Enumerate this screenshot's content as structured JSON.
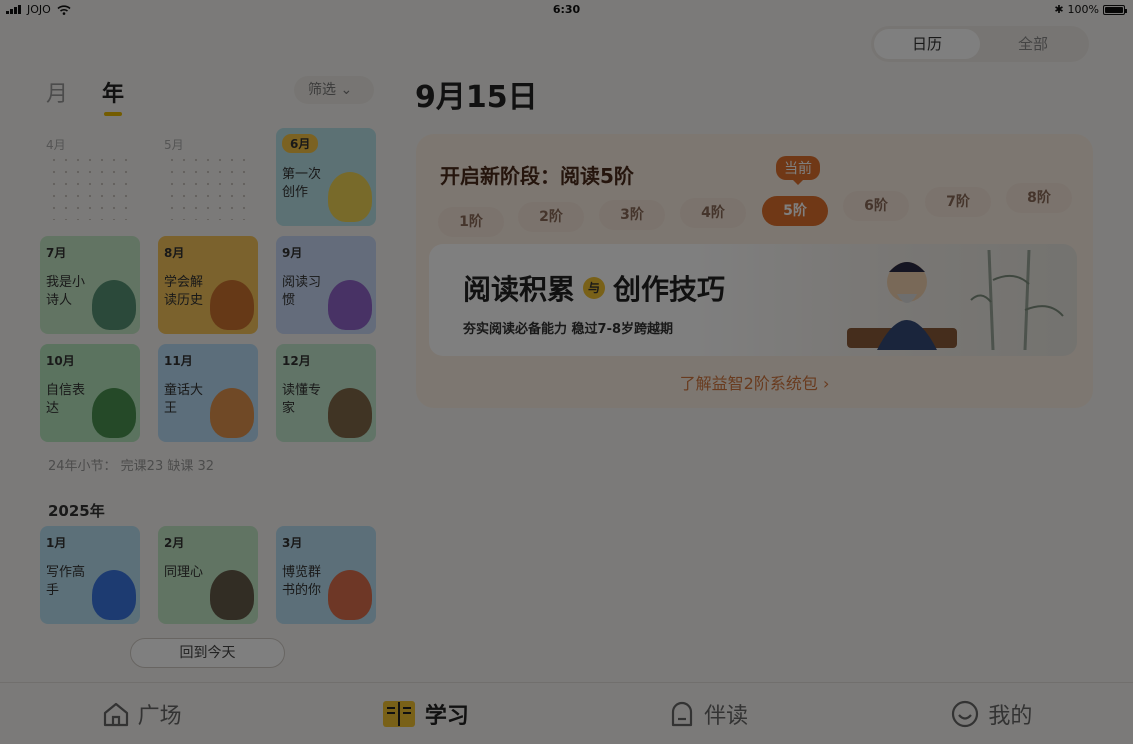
{
  "status": {
    "carrier": "JOJO",
    "time": "6:30",
    "battery": "100%",
    "battery_level": 1.0
  },
  "view_toggle": {
    "options": [
      "日历",
      "全部"
    ],
    "active": "日历"
  },
  "left": {
    "tabs": [
      "月",
      "年"
    ],
    "active_tab": "年",
    "filter_label": "筛选",
    "rows": [
      [
        {
          "month": "4月",
          "label": "",
          "empty": true
        },
        {
          "month": "5月",
          "label": "",
          "empty": true
        },
        {
          "month": "6月",
          "label": "第一次创作",
          "color": "#b8e2e8",
          "mascot": "#f6d445",
          "highlight": true
        }
      ],
      [
        {
          "month": "7月",
          "label": "我是小诗人",
          "color": "#c5e8c6",
          "mascot": "#4a8a6a"
        },
        {
          "month": "8月",
          "label": "学会解读历史",
          "color": "#f6c45a",
          "mascot": "#c86a2a"
        },
        {
          "month": "9月",
          "label": "阅读习惯",
          "color": "#c8d8f6",
          "mascot": "#8a58c6"
        }
      ],
      [
        {
          "month": "10月",
          "label": "自信表达",
          "color": "#b6e6bf",
          "mascot": "#3e8a44"
        },
        {
          "month": "11月",
          "label": "童话大王",
          "color": "#b9dcf6",
          "mascot": "#e48a3a"
        },
        {
          "month": "12月",
          "label": "读懂专家",
          "color": "#c3e8cf",
          "mascot": "#7a5a3a"
        }
      ]
    ],
    "summary": "24年小节：  完课23  缺课 32",
    "year_label": "2025年",
    "rows_2025": [
      {
        "month": "1月",
        "label": "写作高手",
        "color": "#b8e0f2",
        "mascot": "#2e6ae0"
      },
      {
        "month": "2月",
        "label": "同理心",
        "color": "#c3e8c7",
        "mascot": "#5a4a3a"
      },
      {
        "month": "3月",
        "label": "博览群书的你",
        "color": "#b8dff2",
        "mascot": "#e0623a"
      }
    ],
    "today_button": "回到今天"
  },
  "right": {
    "date": "9月15日",
    "stage_title": "开启新阶段：阅读5阶",
    "current_badge": "当前",
    "stages": [
      "1阶",
      "2阶",
      "3阶",
      "4阶",
      "5阶",
      "6阶",
      "7阶",
      "8阶"
    ],
    "active_stage": "5阶",
    "banner_left": "阅读积累",
    "banner_mid": "与",
    "banner_right": "创作技巧",
    "banner_sub": "夯实阅读必备能力  稳过7-8岁跨越期",
    "more_link": "了解益智2阶系统包",
    "more_chevron": "›"
  },
  "nav": [
    {
      "label": "广场",
      "icon": "home-icon"
    },
    {
      "label": "学习",
      "icon": "book-icon",
      "active": true
    },
    {
      "label": "伴读",
      "icon": "bell-icon"
    },
    {
      "label": "我的",
      "icon": "smile-icon"
    }
  ]
}
